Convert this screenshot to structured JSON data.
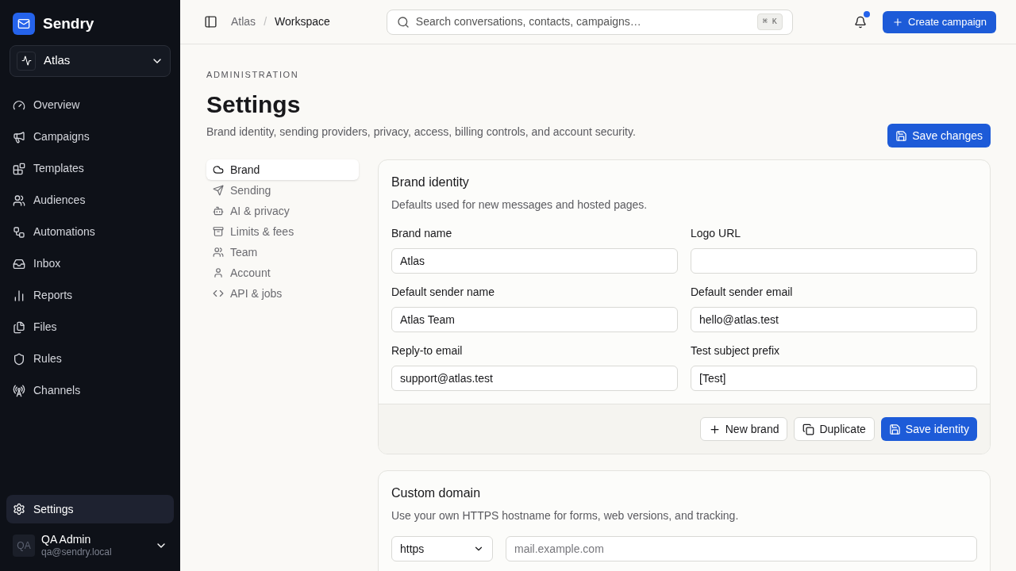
{
  "app": {
    "name": "Sendry"
  },
  "workspace_switcher": {
    "label": "Atlas"
  },
  "nav": [
    {
      "label": "Overview",
      "selected": false
    },
    {
      "label": "Campaigns",
      "selected": false
    },
    {
      "label": "Templates",
      "selected": false
    },
    {
      "label": "Audiences",
      "selected": false
    },
    {
      "label": "Automations",
      "selected": false
    },
    {
      "label": "Inbox",
      "selected": false
    },
    {
      "label": "Reports",
      "selected": false
    },
    {
      "label": "Files",
      "selected": false
    },
    {
      "label": "Rules",
      "selected": false
    },
    {
      "label": "Channels",
      "selected": false
    }
  ],
  "settings_nav": {
    "label": "Settings",
    "selected": true
  },
  "user": {
    "initials": "QA",
    "name": "QA Admin",
    "email": "qa@sendry.local"
  },
  "breadcrumb": [
    "Atlas",
    "/",
    "Workspace"
  ],
  "search": {
    "placeholder": "Search conversations, contacts, campaigns…",
    "shortcut": "⌘ K"
  },
  "notifications": {
    "unread": true
  },
  "create_button": "Create campaign",
  "page": {
    "eyebrow": "ADMINISTRATION",
    "title": "Settings",
    "description": "Brand identity, sending providers, privacy, access, billing controls, and account security.",
    "save_button": "Save changes"
  },
  "settings_tabs": [
    {
      "label": "Brand",
      "selected": true
    },
    {
      "label": "Sending",
      "selected": false
    },
    {
      "label": "AI & privacy",
      "selected": false
    },
    {
      "label": "Limits & fees",
      "selected": false
    },
    {
      "label": "Team",
      "selected": false
    },
    {
      "label": "Account",
      "selected": false
    },
    {
      "label": "API & jobs",
      "selected": false
    }
  ],
  "brand_identity": {
    "title": "Brand identity",
    "description": "Defaults used for new messages and hosted pages.",
    "fields": [
      {
        "label": "Brand name",
        "value": "Atlas"
      },
      {
        "label": "Logo URL"
      },
      {
        "label": "Default sender name",
        "value": "Atlas Team"
      },
      {
        "label": "Default sender email",
        "value": "hello@atlas.test"
      },
      {
        "label": "Reply-to email",
        "value": "support@atlas.test"
      },
      {
        "label": "Test subject prefix",
        "value": "[Test]"
      }
    ],
    "buttons": [
      {
        "label": "New brand",
        "kind": "new"
      },
      {
        "label": "Duplicate",
        "kind": "duplicate"
      },
      {
        "label": "Save identity",
        "kind": "save"
      }
    ]
  },
  "custom_domain": {
    "title": "Custom domain",
    "description": "Use your own HTTPS hostname for forms, web versions, and tracking.",
    "protocol": "https",
    "hostname_placeholder": "mail.example.com"
  }
}
